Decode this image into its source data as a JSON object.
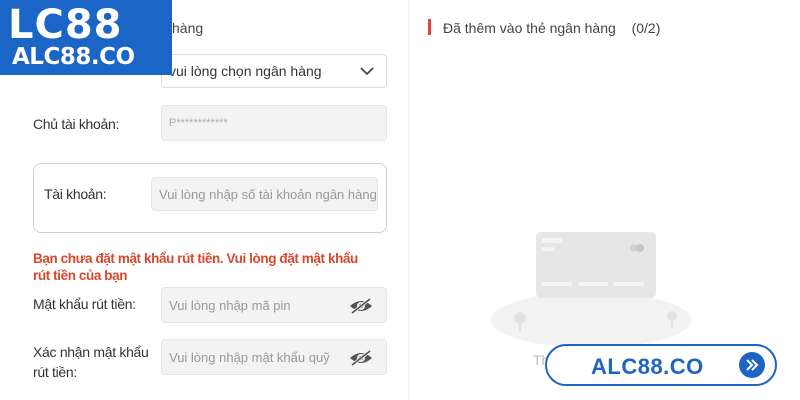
{
  "form": {
    "bank_title_fragment": "hàng",
    "bank_select_value": "vui lòng chọn ngân hàng",
    "account_holder_label": "Chủ tài khoản:",
    "account_holder_value": "P************",
    "account_label": "Tài khoản:",
    "account_placeholder": "Vui lòng nhập số tài khoản ngân hàng",
    "warning_text": "Bạn chưa đặt mật khẩu rút tiền. Vui lòng đặt mật khẩu rút tiền của bạn",
    "pin_label": "Mật khẩu rút tiền:",
    "pin_placeholder": "Vui lòng nhập mã pin",
    "confirm_label_line1": "Xác nhận mật khẩu",
    "confirm_label_line2": "rút tiền:",
    "confirm_placeholder": "Vui lòng nhập mật khẩu quỹ"
  },
  "cards_panel": {
    "title": "Đã thêm vào thẻ ngân hàng",
    "count": "(0/2)",
    "empty_text_fragment": "Th"
  },
  "logo": {
    "main": "LC88",
    "sub": "ALC88.CO"
  },
  "watermark": {
    "text": "ALC88.CO"
  },
  "colors": {
    "accent_red": "#e8403a",
    "warning": "#d9482b",
    "brand_blue": "#1f64c3"
  },
  "icons": [
    "chevron-down-icon",
    "eye-slash-icon",
    "credit-card-icon",
    "double-chevron-right-icon"
  ]
}
